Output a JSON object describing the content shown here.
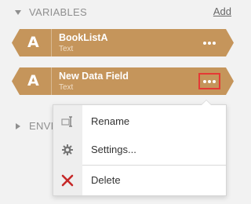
{
  "variables_section": {
    "title": "VARIABLES",
    "add_label": "Add",
    "items": [
      {
        "icon_glyph": "A",
        "name": "BookListA",
        "type": "Text"
      },
      {
        "icon_glyph": "A",
        "name": "New Data Field",
        "type": "Text"
      }
    ]
  },
  "environment_section": {
    "title": "ENVI"
  },
  "context_menu": {
    "items": [
      {
        "label": "Rename",
        "icon": "rename-icon"
      },
      {
        "label": "Settings...",
        "icon": "gear-icon"
      },
      {
        "label": "Delete",
        "icon": "delete-x-icon"
      }
    ]
  },
  "colors": {
    "variable_bg": "#c5955b",
    "highlight": "#e53935",
    "delete_red": "#c62828"
  }
}
